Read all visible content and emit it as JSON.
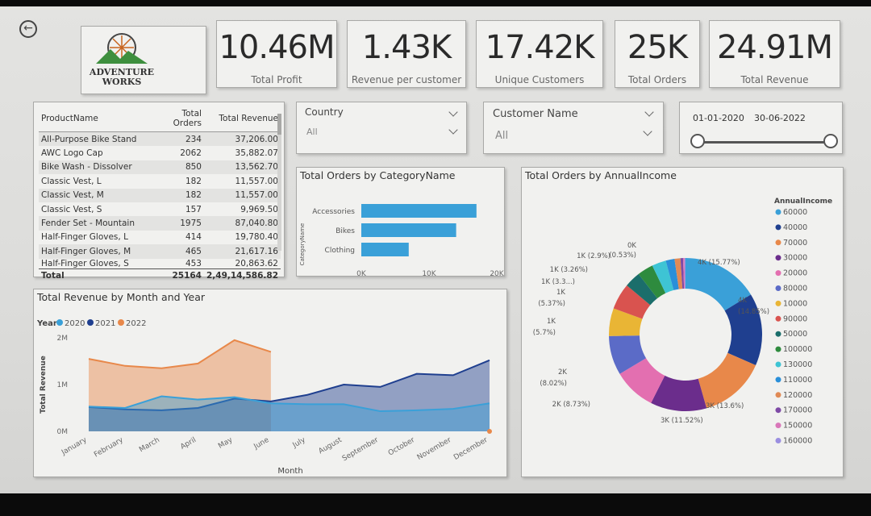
{
  "kpis": [
    {
      "value": "10.46M",
      "label": "Total Profit"
    },
    {
      "value": "1.43K",
      "label": "Revenue per customer"
    },
    {
      "value": "17.42K",
      "label": "Unique Customers"
    },
    {
      "value": "25K",
      "label": "Total Orders"
    },
    {
      "value": "24.91M",
      "label": "Total Revenue"
    }
  ],
  "logo": {
    "line1": "ADVENTURE",
    "line2": "WORKS"
  },
  "product_table": {
    "headers": [
      "ProductName",
      "Total Orders",
      "Total Revenue"
    ],
    "rows": [
      [
        "All-Purpose Bike Stand",
        "234",
        "37,206.00"
      ],
      [
        "AWC Logo Cap",
        "2062",
        "35,882.07"
      ],
      [
        "Bike Wash - Dissolver",
        "850",
        "13,562.70"
      ],
      [
        "Classic Vest, L",
        "182",
        "11,557.00"
      ],
      [
        "Classic Vest, M",
        "182",
        "11,557.00"
      ],
      [
        "Classic Vest, S",
        "157",
        "9,969.50"
      ],
      [
        "Fender Set - Mountain",
        "1975",
        "87,040.80"
      ],
      [
        "Half-Finger Gloves, L",
        "414",
        "19,780.40"
      ],
      [
        "Half-Finger Gloves, M",
        "465",
        "21,617.16"
      ],
      [
        "Half-Finger Gloves, S",
        "453",
        "20,863.62"
      ]
    ],
    "total": [
      "Total",
      "25164",
      "2,49,14,586.82"
    ]
  },
  "slicers": {
    "country": {
      "label": "Country",
      "value": "All"
    },
    "customer": {
      "label": "Customer Name",
      "value": "All"
    },
    "dates": {
      "start": "01-01-2020",
      "end": "30-06-2022"
    }
  },
  "chart_data": [
    {
      "type": "bar",
      "title": "Total Orders by CategoryName",
      "ylabel": "CategoryName",
      "categories": [
        "Accessories",
        "Bikes",
        "Clothing"
      ],
      "values": [
        17000,
        14000,
        7000
      ],
      "xlim": [
        0,
        20000
      ],
      "ticks": [
        "0K",
        "10K",
        "20K"
      ],
      "color": "#3aa0d8"
    },
    {
      "type": "area",
      "title": "Total Revenue by Month and Year",
      "legend_title": "Year",
      "xlabel": "Month",
      "ylabel": "Total Revenue",
      "ylim": [
        0,
        2000000
      ],
      "yticks": [
        "2M",
        "1M",
        "0M"
      ],
      "categories": [
        "January",
        "February",
        "March",
        "April",
        "May",
        "June",
        "July",
        "August",
        "September",
        "October",
        "November",
        "December"
      ],
      "series": [
        {
          "name": "2020",
          "color": "#3aa0d8",
          "values": [
            530000,
            500000,
            750000,
            680000,
            730000,
            600000,
            580000,
            580000,
            430000,
            450000,
            480000,
            600000
          ]
        },
        {
          "name": "2021",
          "color": "#1f3f8f",
          "values": [
            520000,
            470000,
            450000,
            500000,
            700000,
            640000,
            780000,
            1000000,
            950000,
            1230000,
            1200000,
            1520000
          ]
        },
        {
          "name": "2022",
          "color": "#e8884a",
          "values": [
            1550000,
            1400000,
            1350000,
            1450000,
            1950000,
            1700000,
            null,
            null,
            null,
            null,
            null,
            0
          ]
        }
      ]
    },
    {
      "type": "pie",
      "title": "Total Orders by AnnualIncome",
      "legend_title": "AnnualIncome",
      "slices": [
        {
          "name": "60000",
          "value": 15.77,
          "color": "#3aa0d8"
        },
        {
          "name": "40000",
          "value": 14.85,
          "color": "#1f3f8f"
        },
        {
          "name": "70000",
          "value": 13.6,
          "color": "#e8884a"
        },
        {
          "name": "30000",
          "value": 11.52,
          "color": "#6b2d8c"
        },
        {
          "name": "20000",
          "value": 8.73,
          "color": "#e36fb0"
        },
        {
          "name": "80000",
          "value": 8.02,
          "color": "#5b6bc7"
        },
        {
          "name": "10000",
          "value": 5.7,
          "color": "#e9b535"
        },
        {
          "name": "90000",
          "value": 5.37,
          "color": "#d9534f"
        },
        {
          "name": "50000",
          "value": 3.3,
          "color": "#1b6e6b"
        },
        {
          "name": "100000",
          "value": 3.26,
          "color": "#2e8b3e"
        },
        {
          "name": "130000",
          "value": 2.9,
          "color": "#3ec4d4"
        },
        {
          "name": "110000",
          "value": 1.8,
          "color": "#2a8fd9"
        },
        {
          "name": "120000",
          "value": 1.2,
          "color": "#e08a55"
        },
        {
          "name": "170000",
          "value": 0.53,
          "color": "#7e4aa6"
        },
        {
          "name": "150000",
          "value": 0.3,
          "color": "#d977b9"
        },
        {
          "name": "160000",
          "value": 0.2,
          "color": "#9b8fe0"
        }
      ],
      "labels": [
        {
          "text": "4K (15.77%)"
        },
        {
          "text": "4K"
        },
        {
          "text": "(14.85%)"
        },
        {
          "text": "3K (13.6%)"
        },
        {
          "text": "3K (11.52%)"
        },
        {
          "text": "2K (8.73%)"
        },
        {
          "text": "2K"
        },
        {
          "text": "(8.02%)"
        },
        {
          "text": "1K"
        },
        {
          "text": "(5.7%)"
        },
        {
          "text": "1K"
        },
        {
          "text": "(5.37%)"
        },
        {
          "text": "1K (3.3...)"
        },
        {
          "text": "1K (3.26%)"
        },
        {
          "text": "1K (2.9%)"
        },
        {
          "text": "0K"
        },
        {
          "text": "(0.53%)"
        }
      ]
    }
  ]
}
